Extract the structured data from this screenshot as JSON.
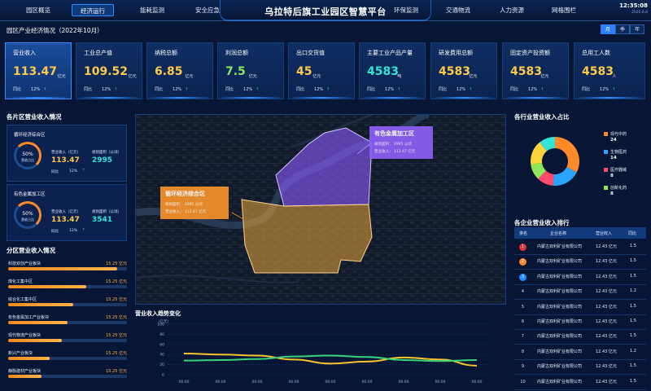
{
  "header": {
    "title": "乌拉特后旗工业园区智慧平台",
    "nav_left": [
      "园区概览",
      "经济运行",
      "能耗监测",
      "安全应急"
    ],
    "nav_right": [
      "环保监测",
      "交通物流",
      "人力资源",
      "网格围栏"
    ],
    "active_nav": "经济运行",
    "clock": "12:35:08",
    "date": "2020.6.8"
  },
  "overview": {
    "title": "园区产业经济情况（2022年10月）",
    "periods": [
      "月",
      "季",
      "年"
    ],
    "active_period": "月",
    "kpis": [
      {
        "label": "营业收入",
        "value": "113.47",
        "unit": "亿元",
        "yoy_label": "同比",
        "yoy": "12%",
        "color": "#ffc94a"
      },
      {
        "label": "工业总产值",
        "value": "109.52",
        "unit": "亿元",
        "yoy_label": "同比",
        "yoy": "12%",
        "color": "#ffc94a"
      },
      {
        "label": "纳税总额",
        "value": "6.85",
        "unit": "亿元",
        "yoy_label": "同比",
        "yoy": "12%",
        "color": "#ffc94a"
      },
      {
        "label": "利润总额",
        "value": "7.5",
        "unit": "亿元",
        "yoy_label": "同比",
        "yoy": "12%",
        "color": "#8ee65a"
      },
      {
        "label": "出口交货值",
        "value": "45",
        "unit": "亿元",
        "yoy_label": "同比",
        "yoy": "12%",
        "color": "#ffc94a"
      },
      {
        "label": "主要工业产品产量",
        "value": "4583",
        "unit": "吨",
        "yoy_label": "同比",
        "yoy": "12%",
        "color": "#35e2d6"
      },
      {
        "label": "研发费用总额",
        "value": "4583",
        "unit": "亿元",
        "yoy_label": "同比",
        "yoy": "12%",
        "color": "#ffc94a"
      },
      {
        "label": "固定资产投资额",
        "value": "4583",
        "unit": "亿元",
        "yoy_label": "同比",
        "yoy": "12%",
        "color": "#ffc94a"
      },
      {
        "label": "总用工人数",
        "value": "4583",
        "unit": "人",
        "yoy_label": "同比",
        "yoy": "12%",
        "color": "#ffc94a"
      }
    ]
  },
  "zones": {
    "title": "各片区营业收入情况",
    "items": [
      {
        "name": "循环经济综合区",
        "ring_value": "50%",
        "ring_label": "营收占比",
        "revenue_label": "营业收入（亿元）",
        "revenue": "113.47",
        "area_label": "规划面积（公顷）",
        "area": "2995",
        "yoy_label": "同比",
        "yoy": "12%"
      },
      {
        "name": "有色金属加工区",
        "ring_value": "50%",
        "ring_label": "营收占比",
        "revenue_label": "营业收入（亿元）",
        "revenue": "113.47",
        "area_label": "规划面积（公顷）",
        "area": "3541",
        "yoy_label": "同比",
        "yoy": "12%"
      }
    ]
  },
  "sub_zones": {
    "title": "分区营业收入情况",
    "items": [
      {
        "name": "科技双创产业板块",
        "value": "15.25 亿元",
        "fill": 0.92
      },
      {
        "name": "煤化工集中区",
        "value": "15.25 亿元",
        "fill": 0.66
      },
      {
        "name": "综合化工集中区",
        "value": "15.25 亿元",
        "fill": 0.55
      },
      {
        "name": "有色金属加工产业板块",
        "value": "15.25 亿元",
        "fill": 0.5
      },
      {
        "name": "现代物流产业板块",
        "value": "15.25 亿元",
        "fill": 0.45
      },
      {
        "name": "新兴产业板块",
        "value": "15.25 亿元",
        "fill": 0.35
      },
      {
        "name": "静脉建材产业板块",
        "value": "15.25 亿元",
        "fill": 0.28
      }
    ]
  },
  "map": {
    "popup_a": {
      "title": "有色金属加工区",
      "l1": "规划面积： 2995 公顷",
      "l2": "营业收入： 113.47 亿元"
    },
    "popup_b": {
      "title": "循环经济综合区",
      "l1": "规划面积： 2995 公顷",
      "l2": "营业收入： 113.47 亿元"
    }
  },
  "trend": {
    "title": "营业收入趋势变化",
    "chart_data": {
      "type": "line",
      "ylabel": "（亿元）",
      "yticks": [
        0,
        20,
        40,
        60,
        80,
        100
      ],
      "ylim": [
        0,
        100
      ],
      "x": [
        "06:00",
        "06:00",
        "06:00",
        "06:00",
        "06:00",
        "06:00",
        "06:00",
        "06:00",
        "06:00"
      ],
      "series": [
        {
          "color": "#f5c430",
          "values": [
            42,
            40,
            38,
            30,
            22,
            26,
            34,
            30,
            18
          ]
        },
        {
          "color": "#36d37a",
          "values": [
            28,
            29,
            31,
            36,
            38,
            35,
            29,
            27,
            29
          ]
        }
      ]
    }
  },
  "industry": {
    "title": "各行业营业收入占比",
    "chart_data": {
      "type": "pie",
      "categories": [
        "现代中药",
        "生物医药",
        "医疗器械",
        "创新化药"
      ],
      "values": [
        24,
        14,
        8,
        8
      ],
      "colors": [
        "#ff8a2a",
        "#2aa4ff",
        "#ff4a6e",
        "#8ee65a"
      ]
    },
    "extra_colors": [
      "#ffd33a",
      "#35e2d6"
    ]
  },
  "ranking": {
    "title": "各企业营业收入排行",
    "headers": [
      "排名",
      "企业名称",
      "营业收入",
      "同比"
    ],
    "rows": [
      {
        "rank": "1",
        "name": "内蒙古双利矿业有限公司",
        "revenue": "12.43 亿元",
        "yoy": "1.5",
        "badge": "#e0343d"
      },
      {
        "rank": "2",
        "name": "内蒙古双利矿业有限公司",
        "revenue": "12.43 亿元",
        "yoy": "1.5",
        "badge": "#ff8a2a"
      },
      {
        "rank": "3",
        "name": "内蒙古双利矿业有限公司",
        "revenue": "12.43 亿元",
        "yoy": "1.5",
        "badge": "#1e8bff"
      },
      {
        "rank": "4",
        "name": "内蒙古双利矿业有限公司",
        "revenue": "12.43 亿元",
        "yoy": "1.2",
        "badge": ""
      },
      {
        "rank": "5",
        "name": "内蒙古双利矿业有限公司",
        "revenue": "12.43 亿元",
        "yoy": "1.5",
        "badge": ""
      },
      {
        "rank": "6",
        "name": "内蒙古双利矿业有限公司",
        "revenue": "12.43 亿元",
        "yoy": "1.5",
        "badge": ""
      },
      {
        "rank": "7",
        "name": "内蒙古双利矿业有限公司",
        "revenue": "12.43 亿元",
        "yoy": "1.5",
        "badge": ""
      },
      {
        "rank": "8",
        "name": "内蒙古双利矿业有限公司",
        "revenue": "12.43 亿元",
        "yoy": "1.2",
        "badge": ""
      },
      {
        "rank": "9",
        "name": "内蒙古双利矿业有限公司",
        "revenue": "12.43 亿元",
        "yoy": "1.5",
        "badge": ""
      },
      {
        "rank": "10",
        "name": "内蒙古双利矿业有限公司",
        "revenue": "12.43 亿元",
        "yoy": "1.5",
        "badge": ""
      }
    ]
  }
}
